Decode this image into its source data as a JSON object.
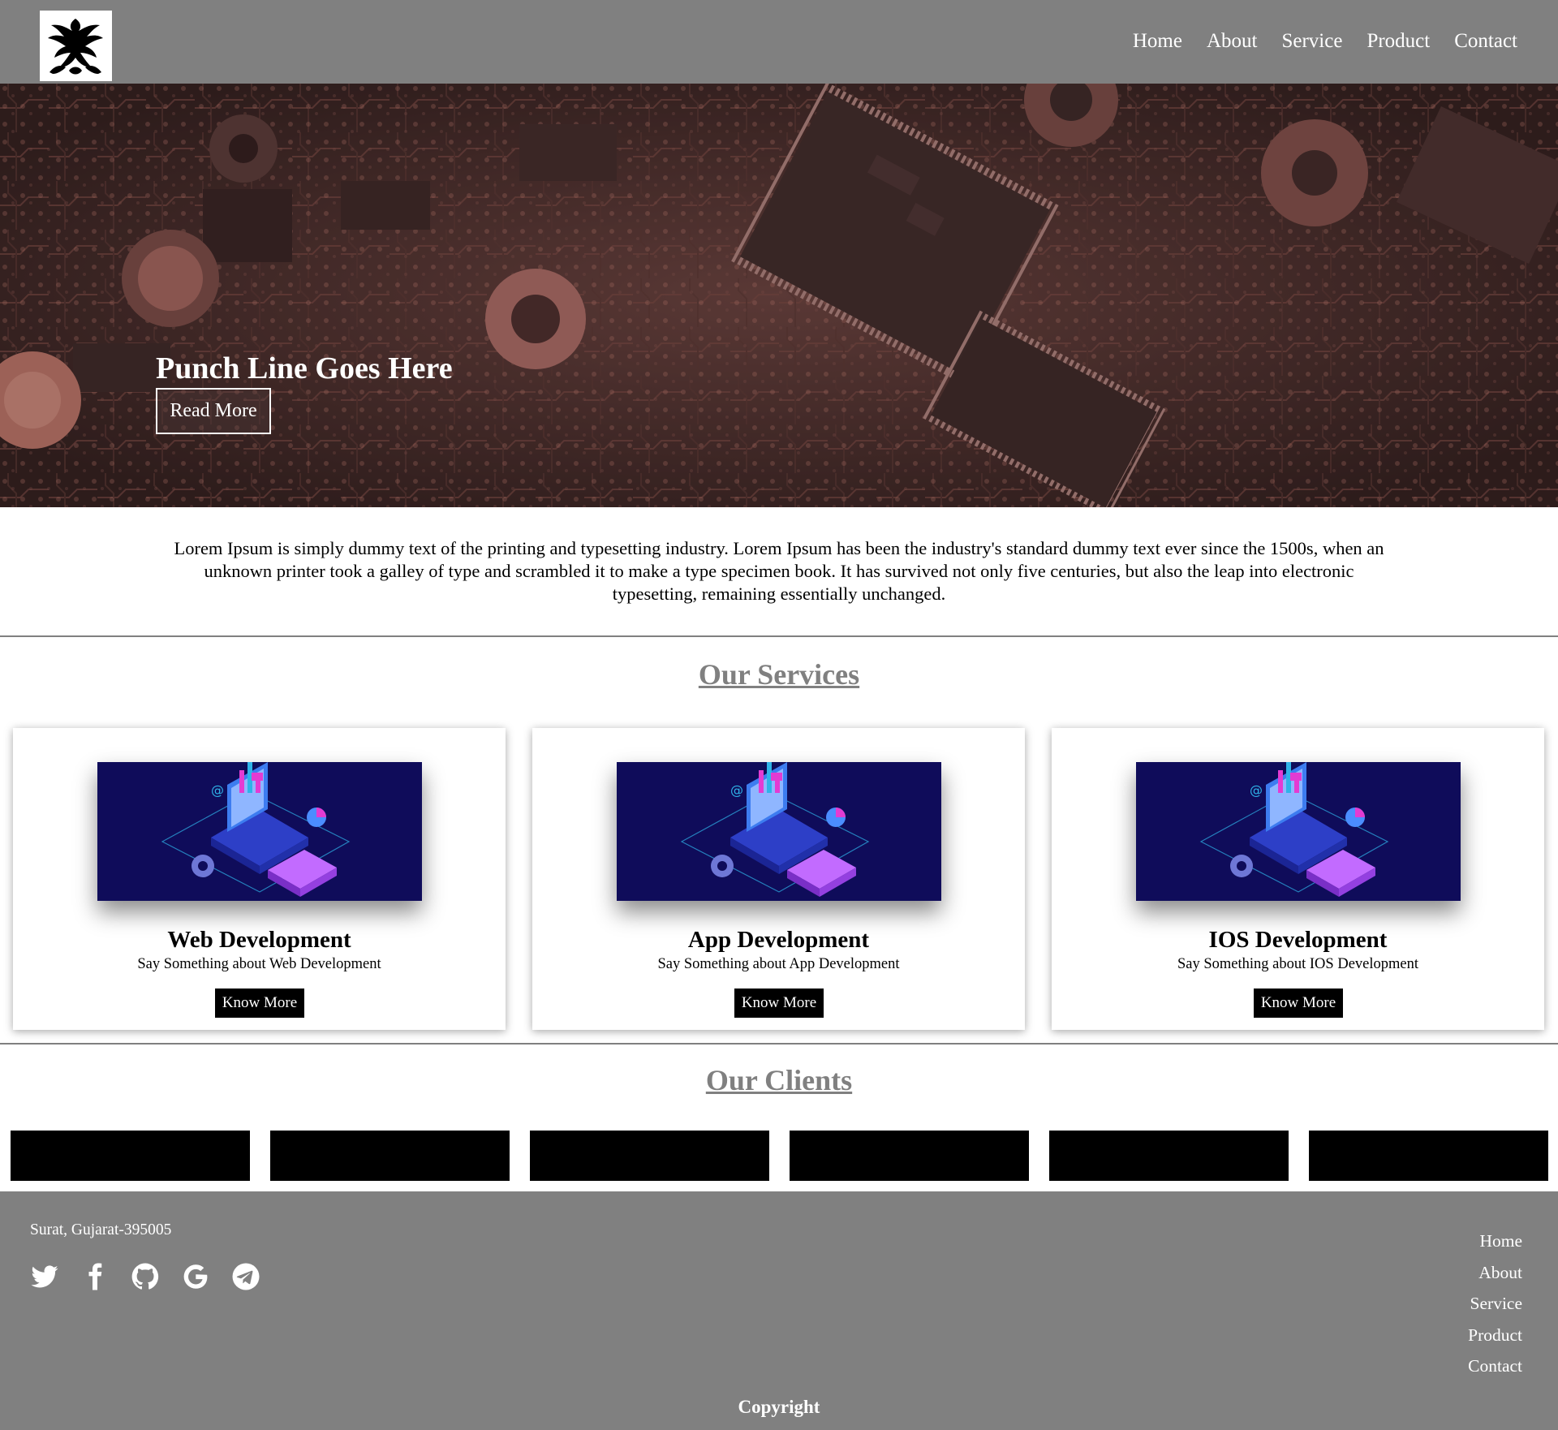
{
  "header": {
    "logo_icon": "phoenix-logo-icon",
    "nav": [
      {
        "label": "Home"
      },
      {
        "label": "About"
      },
      {
        "label": "Service"
      },
      {
        "label": "Product"
      },
      {
        "label": "Contact"
      }
    ]
  },
  "hero": {
    "title": "Punch Line Goes Here",
    "button_label": "Read More"
  },
  "intro": {
    "text": "Lorem Ipsum is simply dummy text of the printing and typesetting industry. Lorem Ipsum has been the industry's standard dummy text ever since the 1500s, when an unknown printer took a galley of type and scrambled it to make a type specimen book. It has survived not only five centuries, but also the leap into electronic typesetting, remaining essentially unchanged."
  },
  "services": {
    "title": "Our Services",
    "cards": [
      {
        "title": "Web Development",
        "description": "Say Something about Web Development",
        "button_label": "Know More"
      },
      {
        "title": "App Development",
        "description": "Say Something about App Development",
        "button_label": "Know More"
      },
      {
        "title": "IOS Development",
        "description": "Say Something about IOS Development",
        "button_label": "Know More"
      }
    ]
  },
  "clients": {
    "title": "Our Clients",
    "count": 6
  },
  "footer": {
    "address": "Surat, Gujarat-395005",
    "socials": [
      "twitter-icon",
      "facebook-icon",
      "github-icon",
      "google-icon",
      "telegram-icon"
    ],
    "nav": [
      {
        "label": "Home"
      },
      {
        "label": "About"
      },
      {
        "label": "Service"
      },
      {
        "label": "Product"
      },
      {
        "label": "Contact"
      }
    ],
    "copyright": "Copyright"
  },
  "colors": {
    "header_bg": "#808080",
    "footer_bg": "#808080",
    "section_title": "#808080",
    "button_dark": "#000000",
    "thumb_bg": "#0f0c5a",
    "thumb_accent": "#e33bd2"
  }
}
